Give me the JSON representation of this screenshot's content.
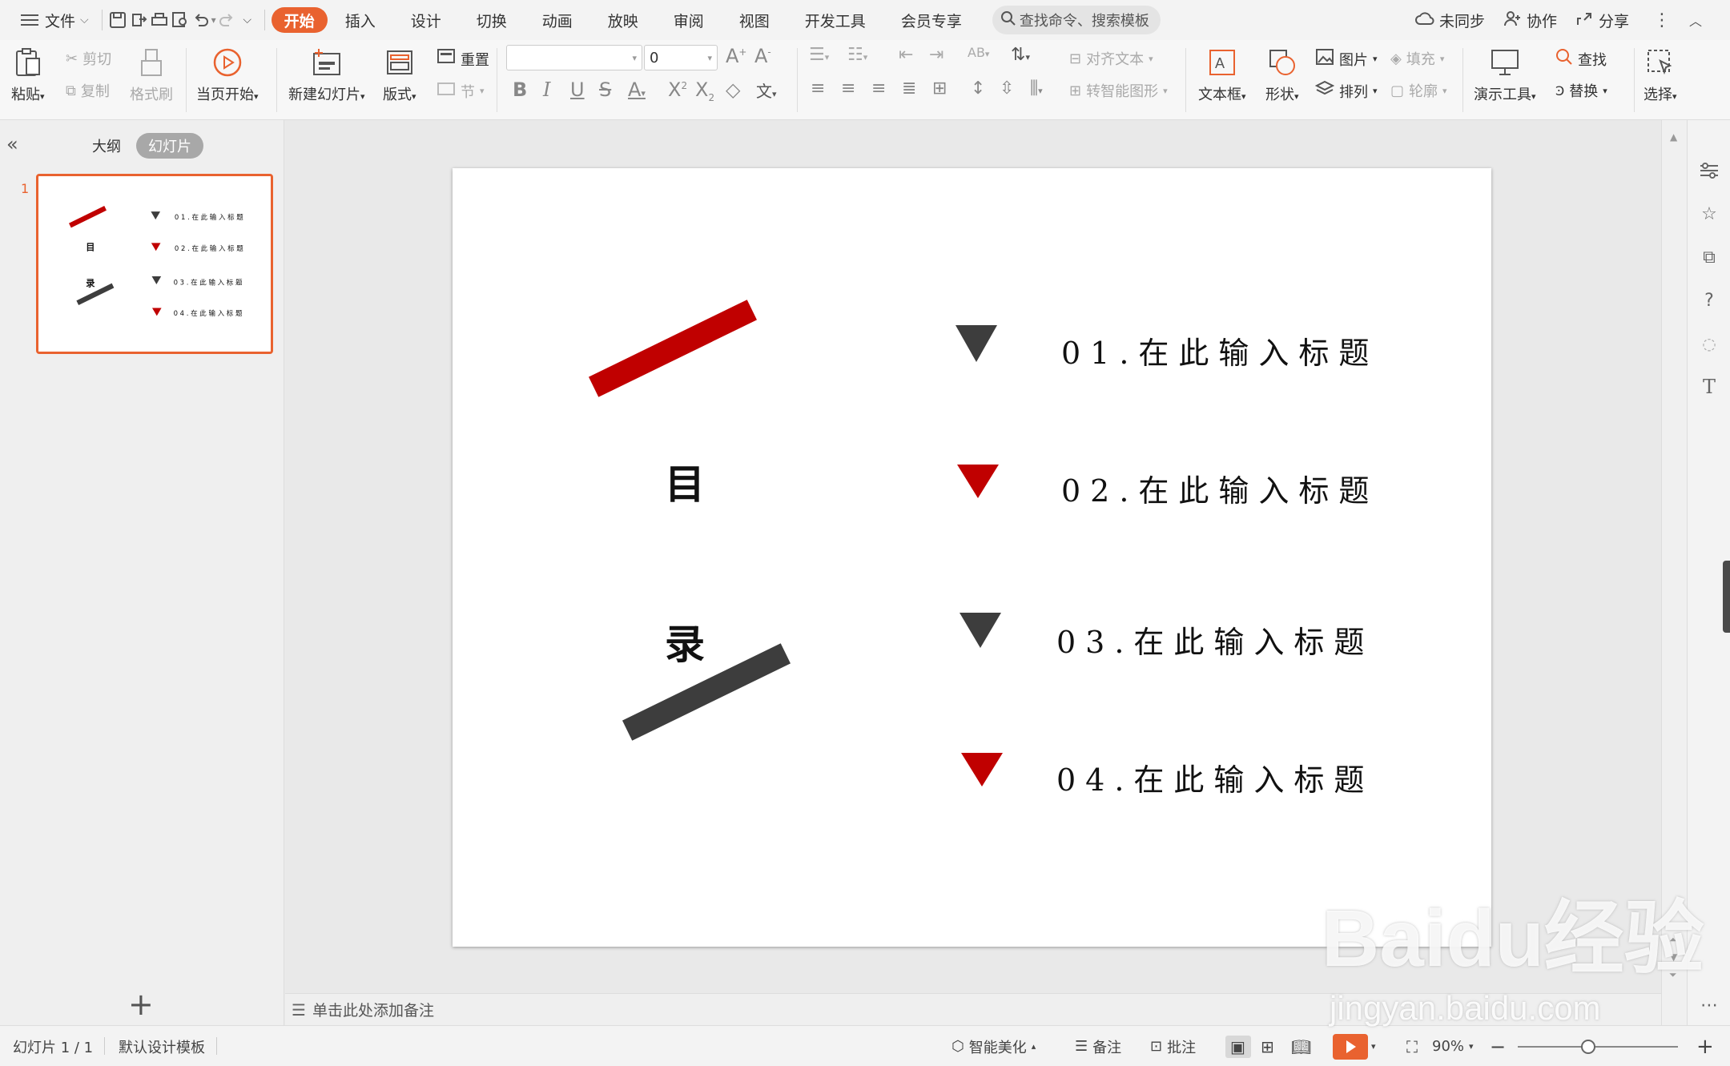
{
  "menubar": {
    "file_label": "文件",
    "tabs": [
      "开始",
      "插入",
      "设计",
      "切换",
      "动画",
      "放映",
      "审阅",
      "视图",
      "开发工具",
      "会员专享"
    ],
    "search_placeholder": "查找命令、搜索模板",
    "sync_label": "未同步",
    "collab_label": "协作",
    "share_label": "分享"
  },
  "ribbon": {
    "paste": "粘贴",
    "cut": "剪切",
    "copy": "复制",
    "format_painter": "格式刷",
    "from_current": "当页开始",
    "new_slide": "新建幻灯片",
    "layout": "版式",
    "reset": "重置",
    "section": "节",
    "font_size": "0",
    "align_text": "对齐文本",
    "smartart": "转智能图形",
    "textbox": "文本框",
    "shape": "形状",
    "picture": "图片",
    "arrange": "排列",
    "fill": "填充",
    "outline": "轮廓",
    "present_tools": "演示工具",
    "find": "查找",
    "replace": "替换",
    "select": "选择"
  },
  "leftpanel": {
    "outline_tab": "大纲",
    "slides_tab": "幻灯片",
    "slide_number": "1"
  },
  "slide": {
    "char1": "目",
    "char2": "录",
    "items": [
      {
        "title": "01.在此输入标题",
        "color": "#3d3d3d"
      },
      {
        "title": "02.在此输入标题",
        "color": "#c00000"
      },
      {
        "title": "03.在此输入标题",
        "color": "#3d3d3d"
      },
      {
        "title": "04.在此输入标题",
        "color": "#c00000"
      }
    ],
    "accent_red": "#c00000",
    "accent_dark": "#3d3d3d"
  },
  "notes": {
    "placeholder": "单击此处添加备注"
  },
  "statusbar": {
    "slide_count": "幻灯片 1 / 1",
    "template": "默认设计模板",
    "beautify": "智能美化",
    "notes": "备注",
    "comments": "批注",
    "zoom": "90%"
  },
  "watermark": {
    "brand": "Baidu经验",
    "url": "jingyan.baidu.com"
  }
}
